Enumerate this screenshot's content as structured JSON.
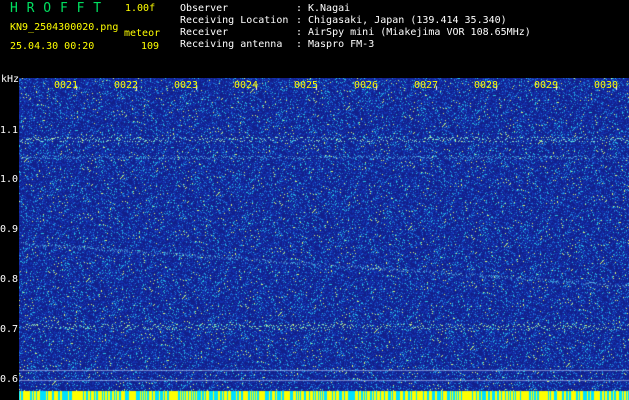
{
  "header": {
    "app_title": "H R O F F T",
    "version": "1.00f",
    "file_name": "KN9_2504300020.png",
    "mode": "meteor",
    "timestamp": "25.04.30 00:20",
    "count": "109"
  },
  "info": [
    {
      "label": "Observer",
      "value": "K.Nagai"
    },
    {
      "label": "Receiving Location",
      "value": "Chigasaki, Japan (139.414 35.340)"
    },
    {
      "label": "Receiver",
      "value": "AirSpy mini (Miakejima VOR 108.65MHz)"
    },
    {
      "label": "Receiving antenna",
      "value": "Maspro FM-3"
    }
  ],
  "separator": ":",
  "axis": {
    "unit": "kHz",
    "y_ticks": [
      "1.1",
      "1.0",
      "0.9",
      "0.8",
      "0.7",
      "0.6"
    ],
    "x_ticks": [
      "0021",
      "0022",
      "0023",
      "0024",
      "0025",
      "0026",
      "0027",
      "0028",
      "0029",
      "0030"
    ]
  },
  "colors": {
    "background": "#000000",
    "spectrogram_base": "#1a2fa0",
    "tick_label": "#ffff00",
    "title": "#00e060",
    "echo_line": "#7fffb0"
  }
}
